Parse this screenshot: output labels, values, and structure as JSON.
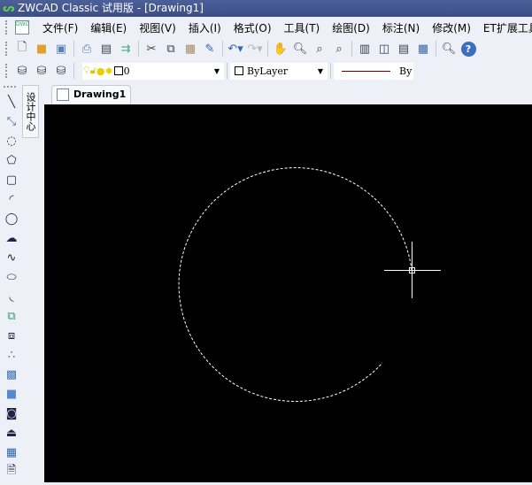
{
  "window": {
    "title": "ZWCAD Classic 试用版 - [Drawing1]"
  },
  "menu": [
    "文件(F)",
    "编辑(E)",
    "视图(V)",
    "插入(I)",
    "格式(O)",
    "工具(T)",
    "绘图(D)",
    "标注(N)",
    "修改(M)",
    "ET扩展工具(X)"
  ],
  "standard_toolbar": [
    "new-icon",
    "open-icon",
    "save-icon",
    "print-icon",
    "print-preview-icon",
    "publish-icon",
    "cut-icon",
    "copy-icon",
    "paste-icon",
    "match-properties-icon",
    "undo-icon",
    "redo-icon",
    "pan-icon",
    "zoom-realtime-icon",
    "zoom-window-icon",
    "zoom-previous-icon",
    "properties-icon",
    "design-center-icon",
    "tool-palette-icon",
    "calculator-icon",
    "search-icon",
    "help-icon"
  ],
  "layers": {
    "current_layer": "0",
    "color": "ByLayer",
    "linetype": "By"
  },
  "left_toolbar": [
    "line-icon",
    "xline-icon",
    "polyline-icon",
    "polygon-icon",
    "rectangle-icon",
    "arc-icon",
    "circle-icon",
    "revcloud-icon",
    "spline-icon",
    "ellipse-icon",
    "ellipse-arc-icon",
    "insert-block-icon",
    "make-block-icon",
    "point-icon",
    "hatch-icon",
    "gradient-icon",
    "region-icon",
    "boundary-icon",
    "table-icon",
    "mtext-icon"
  ],
  "side_tab": "设计中心",
  "doc_tab": "Drawing1",
  "colors": {
    "canvas": "#000000",
    "title": "#3c4e86",
    "entity": "#ffffff"
  }
}
